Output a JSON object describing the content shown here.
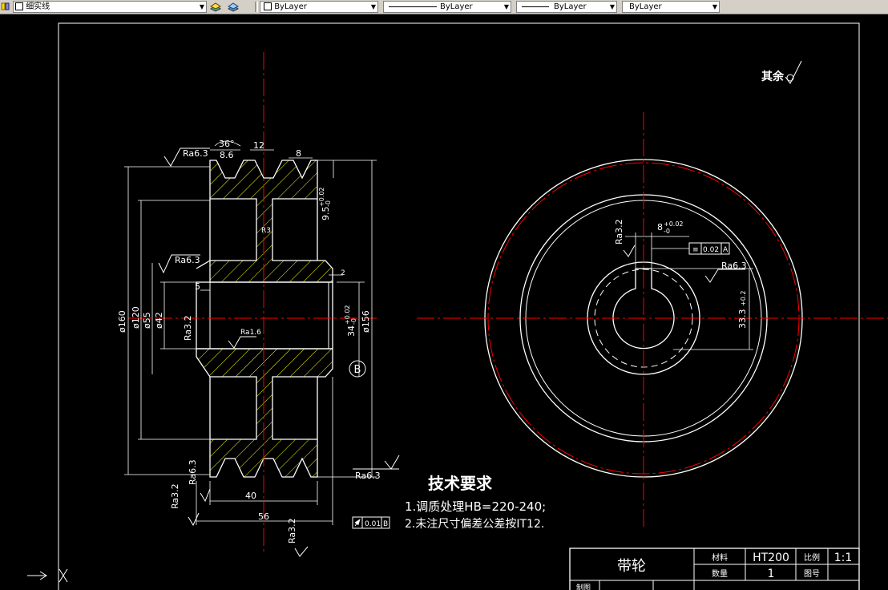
{
  "toolbar": {
    "layer_name": "细实线",
    "color_value": "ByLayer",
    "linetype_value": "ByLayer",
    "lineweight_value": "ByLayer",
    "plotstyle_value": "ByLayer"
  },
  "drawing": {
    "surface_note": "其余",
    "tech_title": "技术要求",
    "tech_line1": "1.调质处理HB=220-240;",
    "tech_line2": "2.未注尺寸偏差公差按IT12.",
    "section_mark": "B",
    "dims": {
      "angle": "36°",
      "d86": "8.6",
      "w12": "12",
      "w8": "8",
      "depth": "9.5",
      "depth_tol_up": "+0.02",
      "depth_tol_dn": "-0",
      "d160": "ø160",
      "d120": "ø120",
      "d55": "ø55",
      "d42": "ø42",
      "d156": "ø156",
      "d34": "34",
      "d34_tol_up": "+0.02",
      "d34_tol_dn": "-0",
      "c5": "5",
      "c2": "2",
      "l40": "40",
      "l56": "56",
      "key8": "8",
      "key8_tol_up": "+0.02",
      "key8_tol_dn": "-0",
      "key33": "33.3",
      "key33_tol": "+0.2",
      "tol_sym": "≡",
      "tol_val": "0.02",
      "tol_datum": "A",
      "runout_val": "0.01",
      "runout_datum": "B",
      "ra63": "Ra6.3",
      "ra32": "Ra3.2",
      "ra16": "Ra1.6",
      "radius": "R3"
    },
    "title_block": {
      "part_name": "带轮",
      "material_label": "材料",
      "material_value": "HT200",
      "scale_label": "比例",
      "scale_value": "1:1",
      "qty_label": "数量",
      "qty_value": "1",
      "drawing_no_label": "图号",
      "drawn_label": "制图"
    }
  },
  "colors": {
    "line": "#ffffff",
    "center": "#ff0000",
    "hatch": "#ffff00",
    "background": "#000000"
  }
}
